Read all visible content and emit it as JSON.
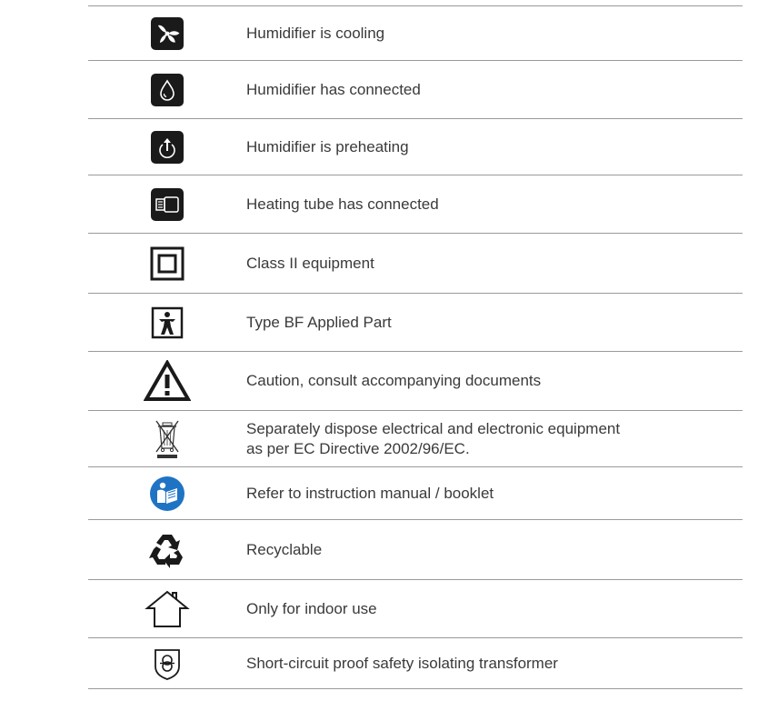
{
  "rows": [
    {
      "icon": "fan-icon",
      "label": "Humidifier is cooling"
    },
    {
      "icon": "water-drop-icon",
      "label": "Humidifier has connected"
    },
    {
      "icon": "preheat-icon",
      "label": "Humidifier is preheating"
    },
    {
      "icon": "heating-tube-icon",
      "label": "Heating tube has connected"
    },
    {
      "icon": "class-ii-icon",
      "label": "Class II equipment"
    },
    {
      "icon": "type-bf-icon",
      "label": "Type BF Applied Part"
    },
    {
      "icon": "caution-icon",
      "label": "Caution, consult accompanying documents"
    },
    {
      "icon": "weee-icon",
      "label": [
        "Separately dispose electrical and electronic equipment",
        "as per EC Directive 2002/96/EC."
      ]
    },
    {
      "icon": "manual-icon",
      "label": "Refer to instruction manual / booklet"
    },
    {
      "icon": "recycle-icon",
      "label": "Recyclable"
    },
    {
      "icon": "indoor-use-icon",
      "label": "Only for indoor use"
    },
    {
      "icon": "transformer-icon",
      "label": "Short-circuit proof safety isolating transformer"
    }
  ],
  "colors": {
    "text": "#3a3a3a",
    "rule": "#9a9a9a",
    "icon_dark": "#1a1a1a",
    "manual_blue": "#1f73c4"
  }
}
